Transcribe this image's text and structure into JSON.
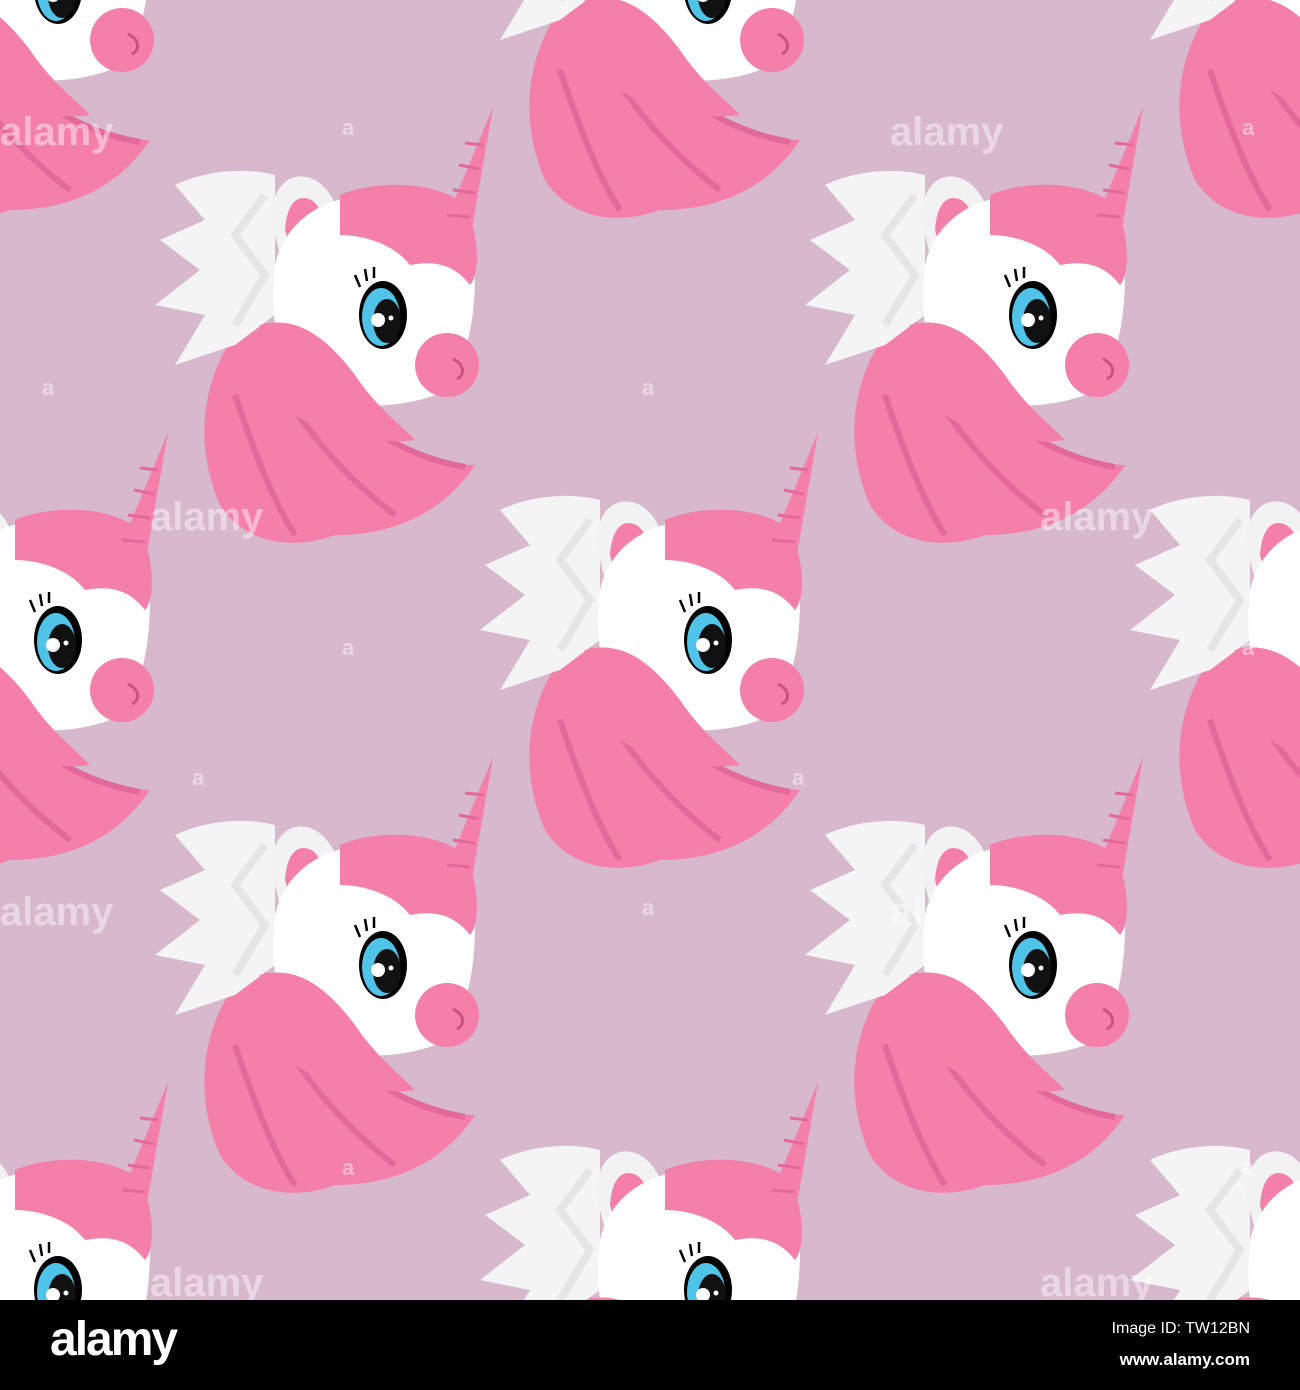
{
  "pattern": {
    "subject": "unicorn-head",
    "colors": {
      "background": "#d7b8cc",
      "mane": "#f47fa8",
      "mane_dark": "#e3699a",
      "face": "#ffffff",
      "wing": "#f4f4f4",
      "eye": "#4fc3e8"
    }
  },
  "watermark": {
    "text": "alamy",
    "letter": "a"
  },
  "footer": {
    "logo": "alamy",
    "image_id": "Image ID: TW12BN",
    "website": "www.alamy.com"
  }
}
